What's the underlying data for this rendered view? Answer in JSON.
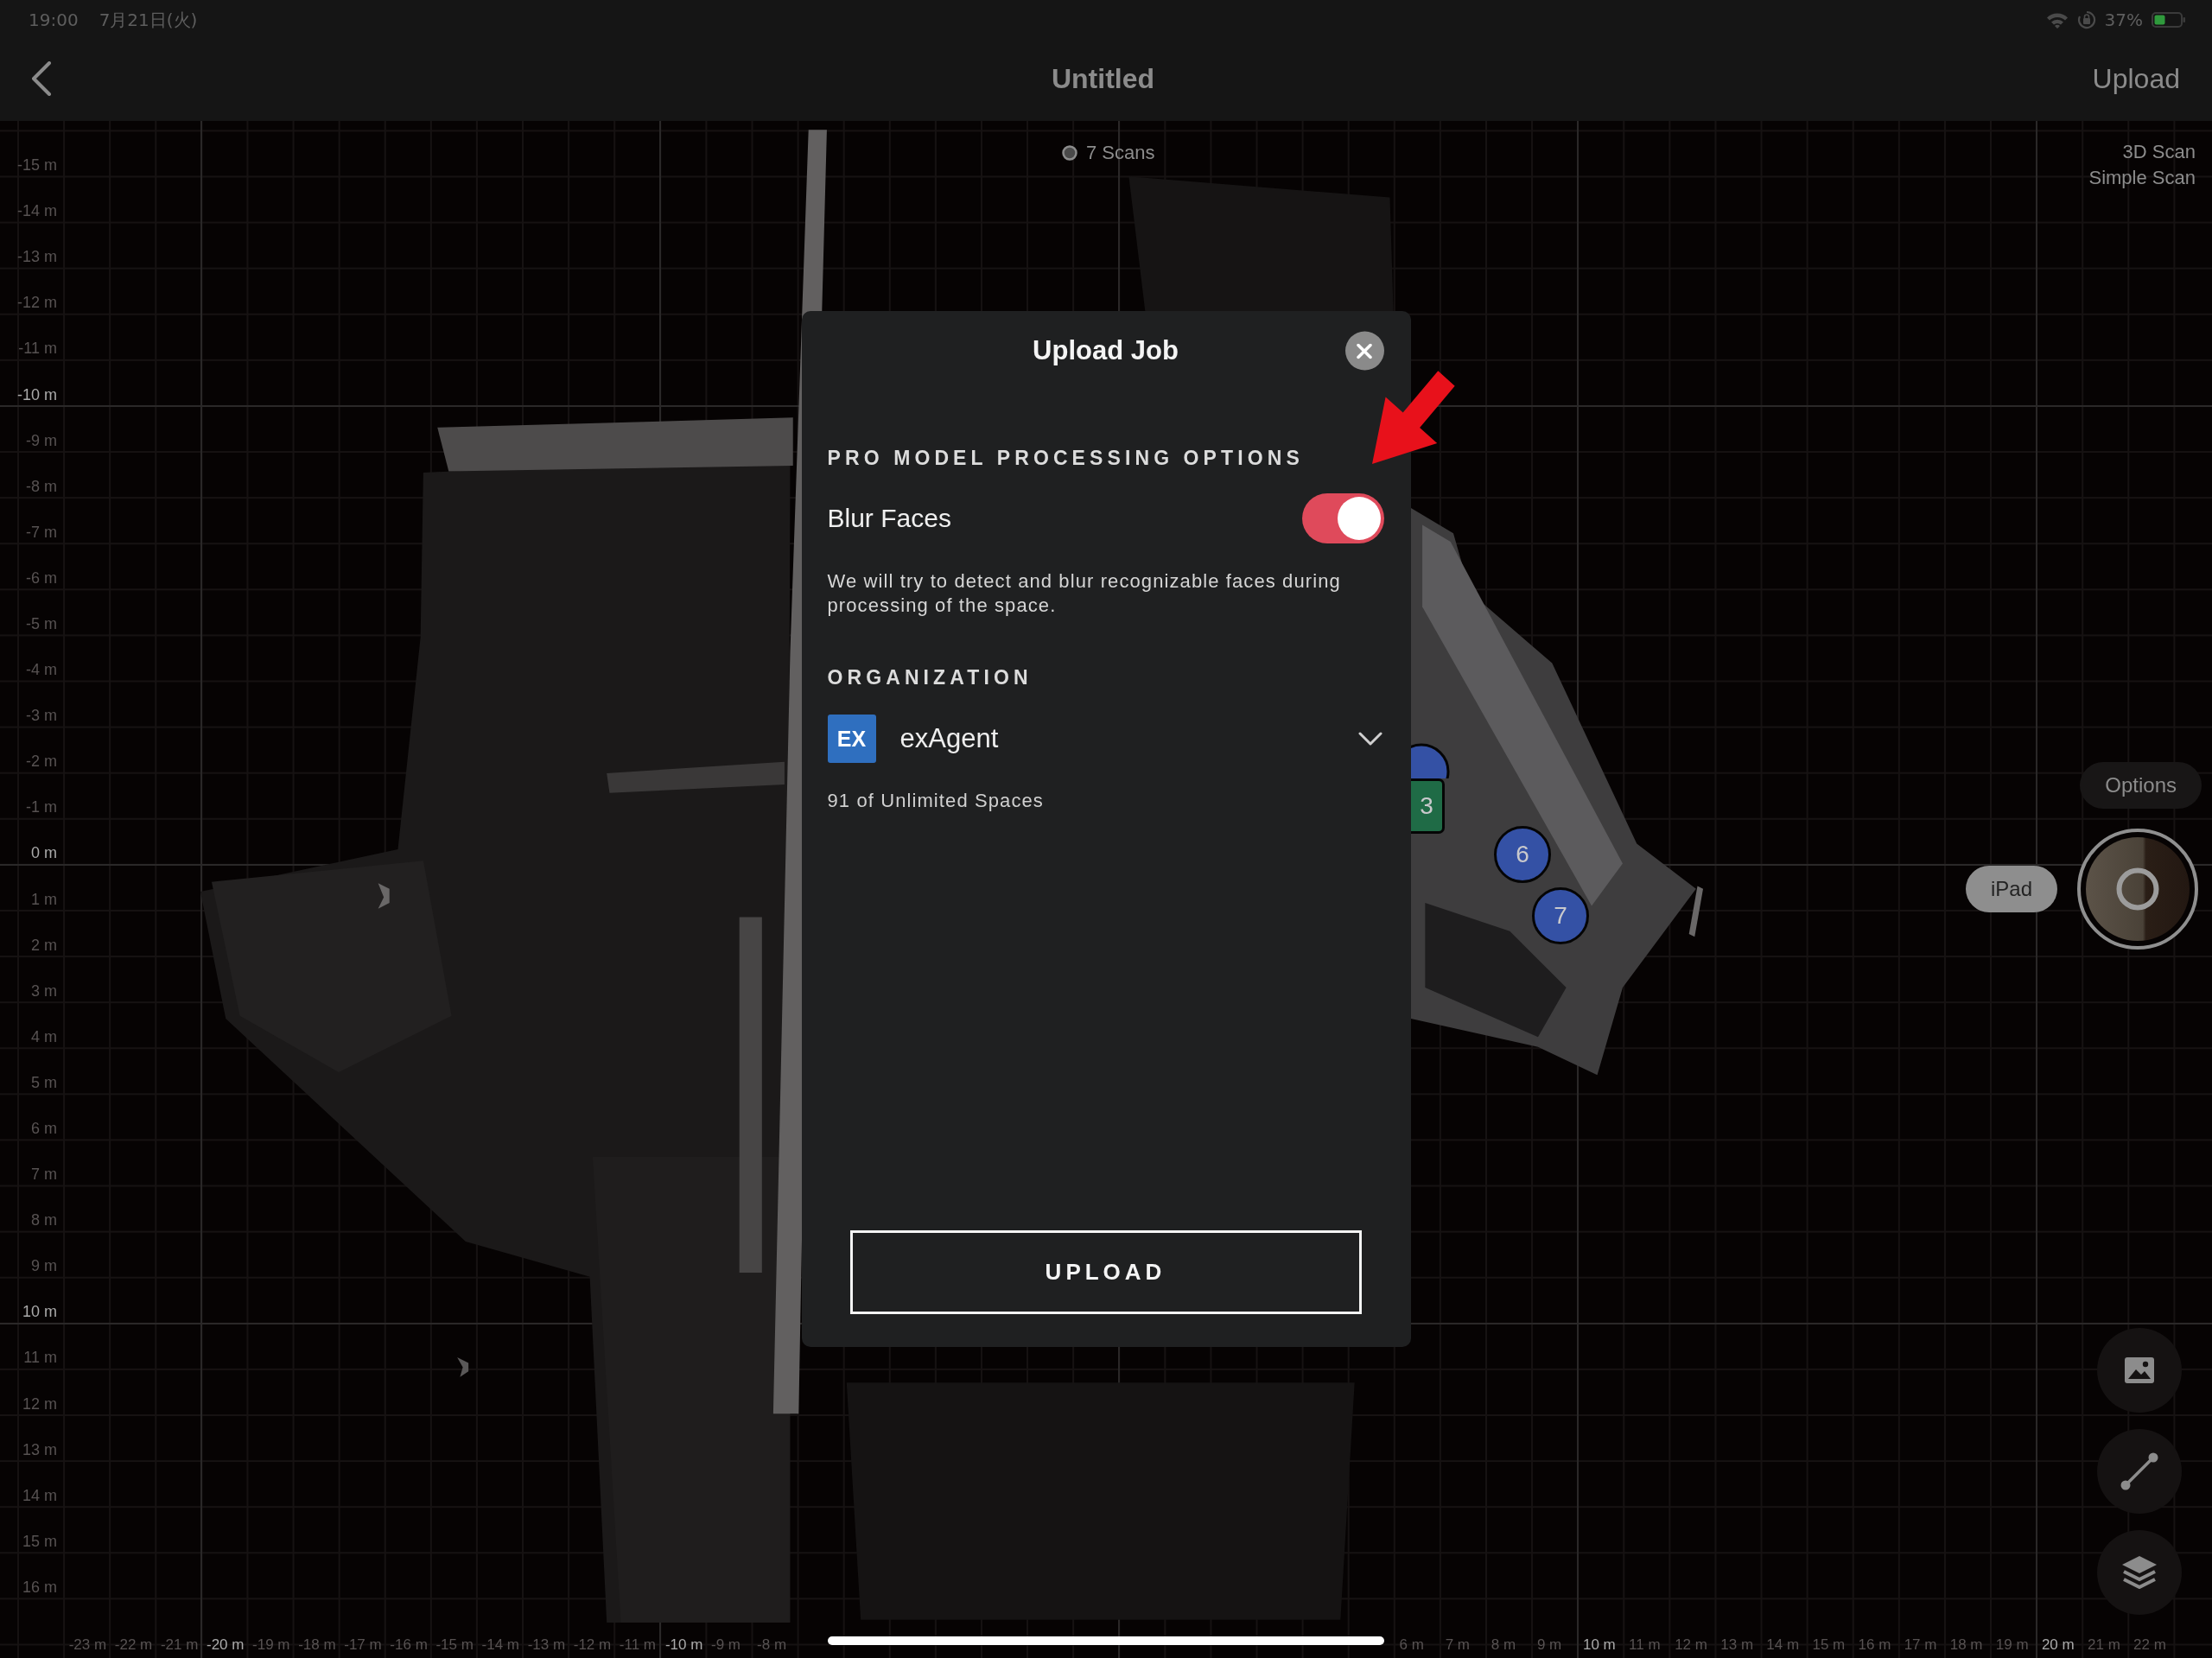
{
  "status_bar": {
    "time": "19:00",
    "date": "7月21日(火)",
    "battery": "37%"
  },
  "nav_bar": {
    "title": "Untitled",
    "action": "Upload"
  },
  "map": {
    "scan_count": "7 Scans",
    "scan_types": [
      "3D Scan",
      "Simple Scan"
    ],
    "y_ruler": [
      {
        "label": "-15 m",
        "major": false
      },
      {
        "label": "-14 m",
        "major": false
      },
      {
        "label": "-13 m",
        "major": false
      },
      {
        "label": "-12 m",
        "major": false
      },
      {
        "label": "-11 m",
        "major": false
      },
      {
        "label": "-10 m",
        "major": true
      },
      {
        "label": "-9 m",
        "major": false
      },
      {
        "label": "-8 m",
        "major": false
      },
      {
        "label": "-7 m",
        "major": false
      },
      {
        "label": "-6 m",
        "major": false
      },
      {
        "label": "-5 m",
        "major": false
      },
      {
        "label": "-4 m",
        "major": false
      },
      {
        "label": "-3 m",
        "major": false
      },
      {
        "label": "-2 m",
        "major": false
      },
      {
        "label": "-1 m",
        "major": false
      },
      {
        "label": "0 m",
        "major": true
      },
      {
        "label": "1 m",
        "major": false
      },
      {
        "label": "2 m",
        "major": false
      },
      {
        "label": "3 m",
        "major": false
      },
      {
        "label": "4 m",
        "major": false
      },
      {
        "label": "5 m",
        "major": false
      },
      {
        "label": "6 m",
        "major": false
      },
      {
        "label": "7 m",
        "major": false
      },
      {
        "label": "8 m",
        "major": false
      },
      {
        "label": "9 m",
        "major": false
      },
      {
        "label": "10 m",
        "major": true
      },
      {
        "label": "11 m",
        "major": false
      },
      {
        "label": "12 m",
        "major": false
      },
      {
        "label": "13 m",
        "major": false
      },
      {
        "label": "14 m",
        "major": false
      },
      {
        "label": "15 m",
        "major": false
      },
      {
        "label": "16 m",
        "major": false
      }
    ],
    "x_ruler_segments": [
      [
        {
          "label": "-23 m",
          "major": false
        },
        {
          "label": "-22 m",
          "major": false
        },
        {
          "label": "-21 m",
          "major": false
        },
        {
          "label": "-20 m",
          "major": true
        },
        {
          "label": "-19 m",
          "major": false
        },
        {
          "label": "-18 m",
          "major": false
        },
        {
          "label": "-17 m",
          "major": false
        },
        {
          "label": "-16 m",
          "major": false
        },
        {
          "label": "-15 m",
          "major": false
        },
        {
          "label": "-14 m",
          "major": false
        },
        {
          "label": "-13 m",
          "major": false
        },
        {
          "label": "-12 m",
          "major": false
        },
        {
          "label": "-11 m",
          "major": false
        },
        {
          "label": "-10 m",
          "major": true
        },
        {
          "label": "-9 m",
          "major": false
        },
        {
          "label": "-8 m",
          "major": false
        }
      ],
      [
        {
          "label": "6 m",
          "major": false
        },
        {
          "label": "7 m",
          "major": false
        },
        {
          "label": "8 m",
          "major": false
        },
        {
          "label": "9 m",
          "major": false
        },
        {
          "label": "10 m",
          "major": true
        },
        {
          "label": "11 m",
          "major": false
        },
        {
          "label": "12 m",
          "major": false
        },
        {
          "label": "13 m",
          "major": false
        },
        {
          "label": "14 m",
          "major": false
        },
        {
          "label": "15 m",
          "major": false
        },
        {
          "label": "16 m",
          "major": false
        },
        {
          "label": "17 m",
          "major": false
        },
        {
          "label": "18 m",
          "major": false
        },
        {
          "label": "19 m",
          "major": false
        },
        {
          "label": "20 m",
          "major": true
        },
        {
          "label": "21 m",
          "major": false
        },
        {
          "label": "22 m",
          "major": false
        }
      ]
    ],
    "scan_markers": [
      {
        "kind": "circle",
        "color": "#3451a5"
      },
      {
        "kind": "square",
        "label": "3",
        "color": "#1f6b46"
      },
      {
        "kind": "circle",
        "label": "6",
        "color": "#3451a5"
      },
      {
        "kind": "circle",
        "label": "7",
        "color": "#3451a5"
      }
    ]
  },
  "side_panel": {
    "options": "Options",
    "device": "iPad"
  },
  "dialog": {
    "title": "Upload Job",
    "processing_heading": "PRO MODEL PROCESSING OPTIONS",
    "blur_faces": {
      "label": "Blur Faces",
      "on": true
    },
    "blur_faces_note": "We will try to detect and blur recognizable faces during processing of the space.",
    "organization_heading": "ORGANIZATION",
    "organization": {
      "initials": "EX",
      "name": "exAgent",
      "usage": "91 of Unlimited Spaces"
    },
    "button": "UPLOAD"
  }
}
